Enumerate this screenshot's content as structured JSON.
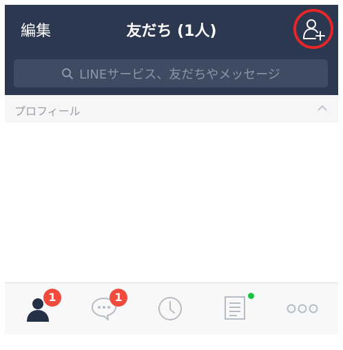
{
  "header": {
    "edit_label": "編集",
    "title": "友だち (1人)",
    "add_friend_icon": "add-friend-icon"
  },
  "search": {
    "placeholder": "LINEサービス、友だちやメッセージ",
    "icon": "search-icon"
  },
  "section": {
    "label": "プロフィール",
    "collapse_icon": "chevron-up-icon"
  },
  "tabbar": {
    "tabs": [
      {
        "icon": "friends-icon",
        "badge": "1",
        "active": true
      },
      {
        "icon": "chat-icon",
        "badge": "1",
        "active": false
      },
      {
        "icon": "timeline-clock-icon",
        "active": false
      },
      {
        "icon": "news-icon",
        "dot": true,
        "active": false
      },
      {
        "icon": "more-icon",
        "active": false
      }
    ]
  },
  "colors": {
    "header_bg": "#2b3850",
    "search_bg": "#3f4b63",
    "highlight_ring": "#e8262a",
    "badge": "#f04b3c",
    "new_dot": "#16c23e"
  }
}
